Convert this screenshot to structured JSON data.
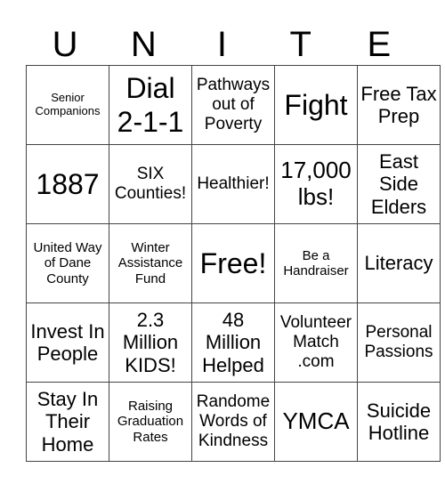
{
  "header": [
    "U",
    "N",
    "I",
    "T",
    "E"
  ],
  "rows": [
    [
      {
        "text": "Senior Companions",
        "size": "s-xs"
      },
      {
        "text": "Dial 2-1-1",
        "size": "s-xxl"
      },
      {
        "text": "Pathways out of Poverty",
        "size": "s-m"
      },
      {
        "text": "Fight",
        "size": "s-xxl"
      },
      {
        "text": "Free Tax Prep",
        "size": "s-l"
      }
    ],
    [
      {
        "text": "1887",
        "size": "s-xxl"
      },
      {
        "text": "SIX Counties!",
        "size": "s-m"
      },
      {
        "text": "Healthier!",
        "size": "s-m"
      },
      {
        "text": "17,000 lbs!",
        "size": "s-xl"
      },
      {
        "text": "East Side Elders",
        "size": "s-l"
      }
    ],
    [
      {
        "text": "United Way of Dane County",
        "size": "s-s"
      },
      {
        "text": "Winter Assistance Fund",
        "size": "s-s"
      },
      {
        "text": "Free!",
        "size": "s-xxl"
      },
      {
        "text": "Be a Handraiser",
        "size": "s-s"
      },
      {
        "text": "Literacy",
        "size": "s-l"
      }
    ],
    [
      {
        "text": "Invest In People",
        "size": "s-l"
      },
      {
        "text": "2.3 Million KIDS!",
        "size": "s-l"
      },
      {
        "text": "48 Million Helped",
        "size": "s-l"
      },
      {
        "text": "Volunteer Match .com",
        "size": "s-m"
      },
      {
        "text": "Personal Passions",
        "size": "s-m"
      }
    ],
    [
      {
        "text": "Stay In Their Home",
        "size": "s-l"
      },
      {
        "text": "Raising Graduation Rates",
        "size": "s-s"
      },
      {
        "text": "Randome Words of Kindness",
        "size": "s-m"
      },
      {
        "text": "YMCA",
        "size": "s-xl"
      },
      {
        "text": "Suicide Hotline",
        "size": "s-l"
      }
    ]
  ]
}
